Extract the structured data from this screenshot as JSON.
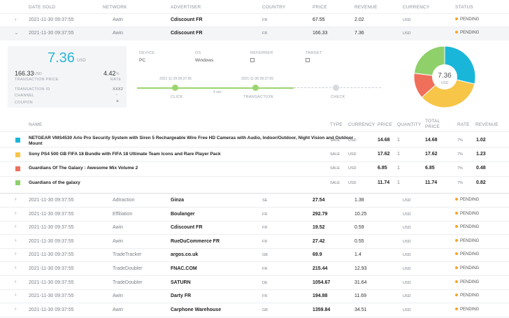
{
  "table": {
    "headers": {
      "date_sold": "DATE SOLD",
      "network": "NETWORK",
      "advertiser": "ADVERTISER",
      "country": "COUNTRY",
      "price": "PRICE",
      "revenue": "REVENUE",
      "currency": "CURRENCY",
      "status": "STATUS"
    },
    "top_rows": [
      {
        "date": "2021-11-30 09:37:55",
        "network": "Awin",
        "advertiser": "Cdiscount FR",
        "country": "FR",
        "price": "67.55",
        "revenue": "2.02",
        "currency": "USD",
        "status": "PENDING"
      },
      {
        "date": "2021-11-30 09:37:55",
        "network": "Awin",
        "advertiser": "Cdiscount FR",
        "country": "FR",
        "price": "166.33",
        "revenue": "7.36",
        "currency": "USD",
        "status": "PENDING"
      }
    ],
    "bottom_rows": [
      {
        "date": "2021-11-30 09:37:55",
        "network": "Adtraction",
        "advertiser": "Ginza",
        "country": "SE",
        "price": "27.54",
        "revenue": "1.38",
        "currency": "USD",
        "status": "PENDING"
      },
      {
        "date": "2021-11-30 09:37:55",
        "network": "Effiliation",
        "advertiser": "Boulanger",
        "country": "FR",
        "price": "292.79",
        "revenue": "10.25",
        "currency": "USD",
        "status": "PENDING"
      },
      {
        "date": "2021-11-30 09:37:55",
        "network": "Awin",
        "advertiser": "Cdiscount FR",
        "country": "FR",
        "price": "19.52",
        "revenue": "0.59",
        "currency": "USD",
        "status": "PENDING"
      },
      {
        "date": "2021-11-30 09:37:55",
        "network": "Awin",
        "advertiser": "RueDuCommerce FR",
        "country": "FR",
        "price": "27.42",
        "revenue": "0.55",
        "currency": "USD",
        "status": "PENDING"
      },
      {
        "date": "2021-11-30 09:37:55",
        "network": "TradeTracker",
        "advertiser": "argos.co.uk",
        "country": "GB",
        "price": "69.9",
        "revenue": "1.4",
        "currency": "USD",
        "status": "PENDING"
      },
      {
        "date": "2021-11-30 09:37:55",
        "network": "TradeDoubler",
        "advertiser": "FNAC.COM",
        "country": "FR",
        "price": "215.44",
        "revenue": "12.93",
        "currency": "USD",
        "status": "PENDING"
      },
      {
        "date": "2021-11-30 09:37:55",
        "network": "TradeDoubler",
        "advertiser": "SATURN",
        "country": "DE",
        "price": "1054.67",
        "revenue": "31.64",
        "currency": "USD",
        "status": "PENDING"
      },
      {
        "date": "2021-11-30 09:37:55",
        "network": "Awin",
        "advertiser": "Darty FR",
        "country": "FR",
        "price": "194.88",
        "revenue": "11.69",
        "currency": "USD",
        "status": "PENDING"
      },
      {
        "date": "2021-11-30 09:37:55",
        "network": "Awin",
        "advertiser": "Carphone Warehouse",
        "country": "GB",
        "price": "1359.84",
        "revenue": "34.51",
        "currency": "USD",
        "status": "PENDING"
      }
    ]
  },
  "detail": {
    "revenue_value": "7.36",
    "revenue_currency": "USD",
    "transaction_price": "166.33",
    "transaction_price_currency": "USD",
    "transaction_price_label": "TRANSACTION PRICE",
    "rate_value": "4.42",
    "rate_unit": "%",
    "rate_label": "RATE",
    "transaction_id_label": "TRANSACTION ID",
    "transaction_id_value": "XXX2",
    "channel_label": "CHANNEL",
    "channel_value": "-",
    "coupon_label": "COUPON",
    "coupon_value": "×",
    "device_label": "DEVICE",
    "device_value": "PC",
    "os_label": "OS",
    "os_value": "Windows",
    "referrer_label": "REFERRER",
    "target_label": "TARGET",
    "timeline": {
      "click_label": "CLICK",
      "click_time": "2021-11-29 09:37:55",
      "transaction_label": "TRANSACTION",
      "transaction_time": "2021-11-30 09:37:55",
      "check_label": "CHECK",
      "gap_label": "4 sec"
    },
    "donut": {
      "center_value": "7.36",
      "center_currency": "USD",
      "slices": [
        {
          "color": "#1ab6d9",
          "value": 1.02
        },
        {
          "color": "#f7c548",
          "value": 1.23
        },
        {
          "color": "#f06f5b",
          "value": 0.48
        },
        {
          "color": "#8fd06a",
          "value": 0.82
        }
      ]
    }
  },
  "products": {
    "headers": {
      "name": "NAME",
      "type": "TYPE",
      "currency": "CURRENCY",
      "price": "PRICE",
      "quantity": "QUANTITY",
      "total_price_1": "TOTAL",
      "total_price_2": "PRICE",
      "rate": "RATE",
      "revenue": "REVENUE"
    },
    "items": [
      {
        "color": "#1ab6d9",
        "name_1": "NETGEAR VMS4530 Arlo Pro Security System with Siren 5 Rechargeable Wire Free HD Cameras with Audio, Indoor/Outdoor, Night Vision and Outdoor",
        "name_2": "Mount",
        "type": "SALE",
        "currency": "USD",
        "price": "14.68",
        "quantity": "1",
        "total": "14.68",
        "rate": "7%",
        "revenue": "1.02"
      },
      {
        "color": "#f7c548",
        "name_1": "Sony PS4 500 GB FIFA 18 Bundle with FIFA 18 Ultimate Team Icons and Rare Player Pack",
        "name_2": "",
        "type": "SALE",
        "currency": "USD",
        "price": "17.62",
        "quantity": "1",
        "total": "17.62",
        "rate": "7%",
        "revenue": "1.23"
      },
      {
        "color": "#f06f5b",
        "name_1": "Guardians Of The Galaxy : Awesome Mix Volume 2",
        "name_2": "",
        "type": "SALE",
        "currency": "USD",
        "price": "6.85",
        "quantity": "1",
        "total": "6.85",
        "rate": "7%",
        "revenue": "0.48"
      },
      {
        "color": "#8fd06a",
        "name_1": "Guardians of the galaxy",
        "name_2": "",
        "type": "SALE",
        "currency": "USD",
        "price": "11.74",
        "quantity": "1",
        "total": "11.74",
        "rate": "7%",
        "revenue": "0.82"
      }
    ]
  }
}
